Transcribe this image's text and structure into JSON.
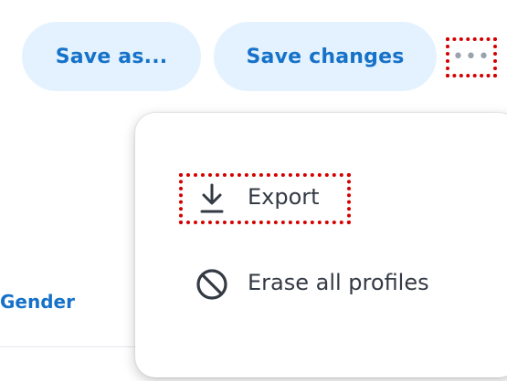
{
  "toolbar": {
    "save_as_label": "Save as...",
    "save_changes_label": "Save changes",
    "more_label": "•••"
  },
  "table": {
    "column_header": "Gender"
  },
  "menu": {
    "items": [
      {
        "label": "Export",
        "icon": "download-icon"
      },
      {
        "label": "Erase all profiles",
        "icon": "block-icon"
      }
    ]
  },
  "colors": {
    "accent": "#1672c9",
    "pill_bg": "#e3f2fe",
    "highlight": "#d40000",
    "menu_text": "#333a44"
  }
}
